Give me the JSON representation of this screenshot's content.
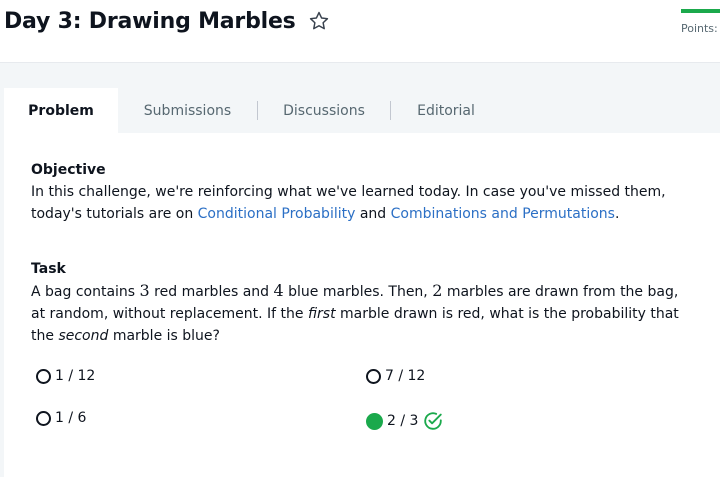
{
  "header": {
    "title": "Day 3: Drawing Marbles",
    "points_label": "Points:",
    "star_icon": "star-outline-icon"
  },
  "tabs": [
    {
      "label": "Problem",
      "active": true
    },
    {
      "label": "Submissions",
      "active": false
    },
    {
      "label": "Discussions",
      "active": false
    },
    {
      "label": "Editorial",
      "active": false
    }
  ],
  "objective": {
    "heading": "Objective",
    "text_before": "In this challenge, we're reinforcing what we've learned today. In case you've missed them, today's tutorials are on ",
    "link1": "Conditional Probability",
    "text_mid": " and ",
    "link2": "Combinations and Permutations",
    "text_after": "."
  },
  "task": {
    "heading": "Task",
    "s1": "A bag contains ",
    "n1": "3",
    "s2": " red marbles and ",
    "n2": "4",
    "s3": " blue marbles. Then, ",
    "n3": "2",
    "s4": " marbles are drawn from the bag, at random, without replacement. If the ",
    "em1": "first",
    "s5": " marble drawn is red, what is the probability that the ",
    "em2": "second",
    "s6": " marble is blue?"
  },
  "options": [
    {
      "label": "1 / 12",
      "selected": false
    },
    {
      "label": "7 / 12",
      "selected": false
    },
    {
      "label": "1 / 6",
      "selected": false
    },
    {
      "label": "2 / 3",
      "selected": true,
      "correct": true
    }
  ],
  "colors": {
    "accent_green": "#1ba94c",
    "link_blue": "#2b6fc5"
  }
}
